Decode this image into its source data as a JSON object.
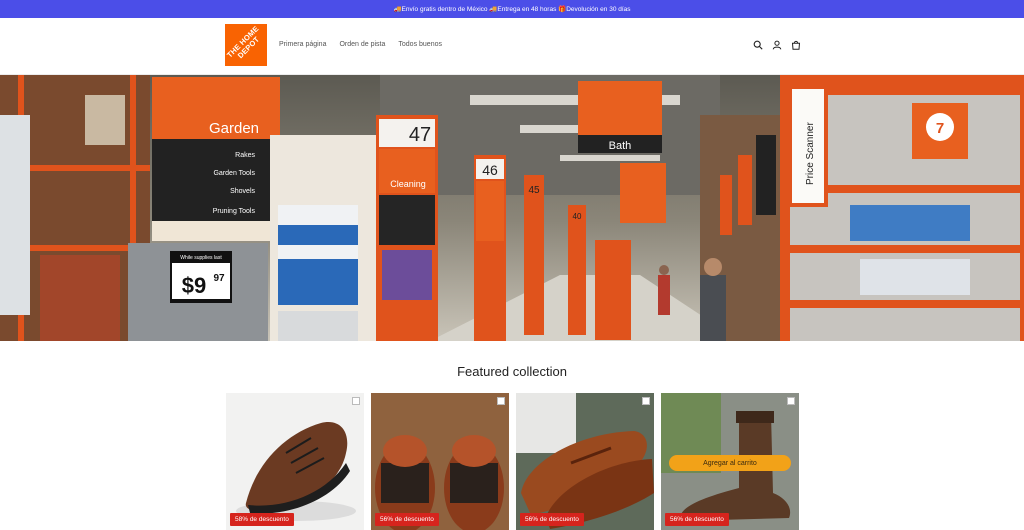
{
  "announcement": "🚚Envío gratis dentro de México 🚚Entrega en 48 horas 🎁Devolución en 30 días",
  "logo": {
    "text": "THE HOME DEPOT",
    "color": "#f96302"
  },
  "nav": [
    "Primera página",
    "Orden de pista",
    "Todos buenos"
  ],
  "header_icons": [
    "search-icon",
    "account-icon",
    "cart-icon"
  ],
  "hero": {
    "signs": {
      "garden": "Garden",
      "garden_list": [
        "Rakes",
        "Garden Tools",
        "Shovels",
        "Pruning Tools"
      ],
      "aisle47": "47",
      "cleaning": "Cleaning",
      "aisle46": "46",
      "aisle45": "45",
      "aisle40": "40",
      "bath": "Bath",
      "price_scanner": "Price Scanner",
      "aisle7": "7",
      "price_big": "$9",
      "price_cents": "97",
      "price_caption": "While supplies last"
    }
  },
  "section_title": "Featured collection",
  "products": [
    {
      "badge": "58% de descuento",
      "image": "brown leather sneaker"
    },
    {
      "badge": "56% de descuento",
      "image": "brown brogue shoes"
    },
    {
      "badge": "56% de descuento",
      "image": "brown penny loafers"
    },
    {
      "badge": "56% de descuento",
      "image": "brown chelsea boot",
      "cta": "Agregar al carrito"
    }
  ],
  "colors": {
    "announcement_bg": "#4b4ee8",
    "badge": "#d6241d",
    "cta": "#f2a218",
    "brand": "#f96302"
  }
}
